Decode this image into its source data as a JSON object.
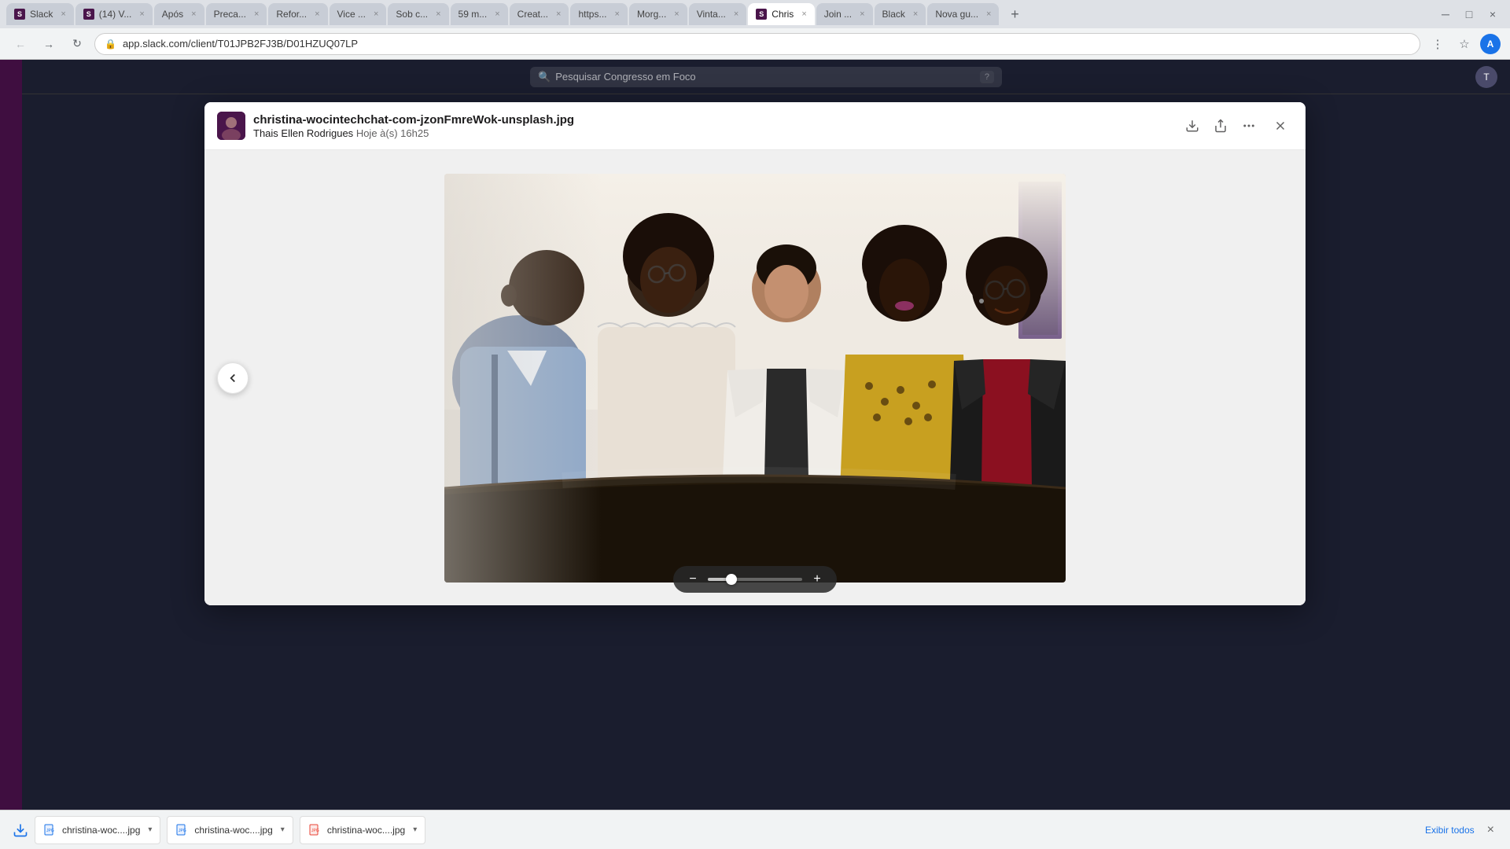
{
  "browser": {
    "address": "app.slack.com/client/T01JPB2FJ3B/D01HZUQ07LP",
    "tabs": [
      {
        "id": "slack",
        "label": "Slack",
        "favicon_text": "S",
        "active": false
      },
      {
        "id": "14v",
        "label": "(14) V...",
        "favicon_text": "S",
        "active": false
      },
      {
        "id": "apos",
        "label": "Após",
        "favicon_text": "",
        "active": false
      },
      {
        "id": "preca",
        "label": "Preca...",
        "favicon_text": "",
        "active": false
      },
      {
        "id": "refor",
        "label": "Refor...",
        "favicon_text": "",
        "active": false
      },
      {
        "id": "vice",
        "label": "Vice ...",
        "favicon_text": "",
        "active": false
      },
      {
        "id": "sob",
        "label": "Sob c...",
        "favicon_text": "",
        "active": false
      },
      {
        "id": "59m",
        "label": "59 m...",
        "favicon_text": "",
        "active": false
      },
      {
        "id": "creat",
        "label": "Creat...",
        "favicon_text": "",
        "active": false
      },
      {
        "id": "https",
        "label": "https...",
        "favicon_text": "",
        "active": false
      },
      {
        "id": "morg",
        "label": "Morg...",
        "favicon_text": "",
        "active": false
      },
      {
        "id": "vinta",
        "label": "Vinta...",
        "favicon_text": "",
        "active": false
      },
      {
        "id": "chris",
        "label": "Chris",
        "favicon_text": "S",
        "active": true
      },
      {
        "id": "join",
        "label": "Join ...",
        "favicon_text": "",
        "active": false
      },
      {
        "id": "black",
        "label": "Black",
        "favicon_text": "",
        "active": false
      },
      {
        "id": "nova",
        "label": "Nova gu...",
        "favicon_text": "",
        "active": false
      }
    ]
  },
  "slack_search": {
    "placeholder": "Pesquisar Congresso em Foco"
  },
  "image_viewer": {
    "filename": "christina-wocintechchat-com-jzonFmreWok-unsplash.jpg",
    "uploader": "Thais Ellen Rodrigues",
    "timestamp": "Hoje à(s) 16h25",
    "download_icon": "⬇",
    "share_icon": "↗",
    "more_icon": "•••",
    "close_icon": "×",
    "back_arrow": "←"
  },
  "zoom_controls": {
    "minus": "−",
    "plus": "+"
  },
  "downloads": [
    {
      "name": "christina-woc....jpg",
      "icon_color": "#1a73e8"
    },
    {
      "name": "christina-woc....jpg",
      "icon_color": "#1a73e8"
    },
    {
      "name": "christina-woc....jpg",
      "icon_color": "#1a73e8"
    }
  ],
  "downloads_bar": {
    "show_all": "Exibir todos",
    "close": "×"
  },
  "detected": {
    "chris_tab": "Chris",
    "black_tab": "Black"
  }
}
